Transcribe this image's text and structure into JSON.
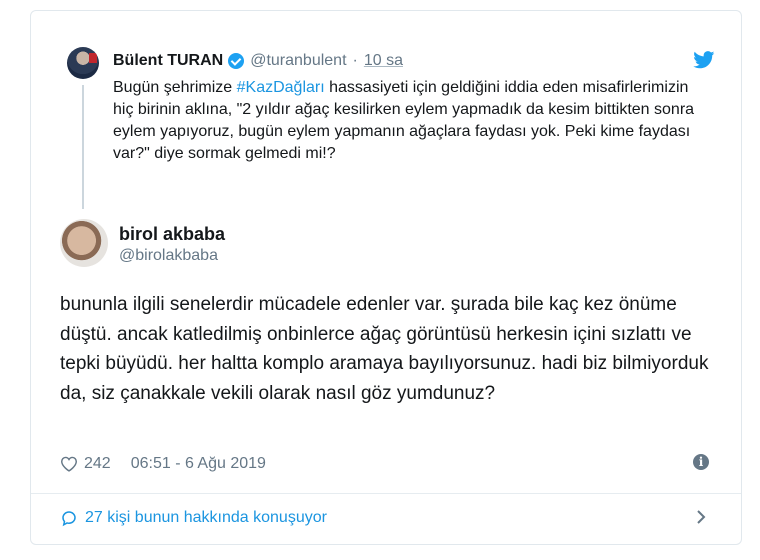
{
  "quoted_tweet": {
    "name": "Bülent TURAN",
    "handle": "@turanbulent",
    "separator": "·",
    "time": "10 sa",
    "text_before": "Bugün şehrimize ",
    "hashtag": "#KazDağları",
    "text_after": " hassasiyeti için geldiğini iddia eden misafirlerimizin hiç birinin aklına, \"2 yıldır ağaç kesilirken eylem yapmadık da kesim bittikten sonra eylem yapıyoruz, bugün eylem yapmanın ağaçlara faydası yok. Peki kime faydası var?\" diye sormak gelmedi mi!?"
  },
  "tweet": {
    "name": "birol akbaba",
    "handle": "@birolakbaba",
    "text": "bununla ilgili senelerdir mücadele edenler var. şurada bile kaç kez önüme düştü. ancak katledilmiş onbinlerce ağaç görüntüsü herkesin içini sızlattı ve tepki büyüdü. her haltta komplo aramaya bayılıyorsunuz. hadi biz bilmiyorduk da, siz çanakkale vekili olarak nasıl göz yumdunuz?",
    "likes": "242",
    "timestamp": "06:51 - 6 Ağu 2019"
  },
  "conversation": {
    "label": "27 kişi bunun hakkında konuşuyor"
  },
  "icons": {
    "verified": "verified-badge-icon",
    "twitter": "twitter-bird-icon",
    "like": "heart-icon",
    "info": "info-icon",
    "reply": "speech-bubble-icon",
    "expand": "chevron-right-icon"
  },
  "colors": {
    "accent": "#1da1f2",
    "link": "#1b95e0",
    "muted": "#657786",
    "text": "#14171a",
    "border": "#e1e8ed"
  }
}
